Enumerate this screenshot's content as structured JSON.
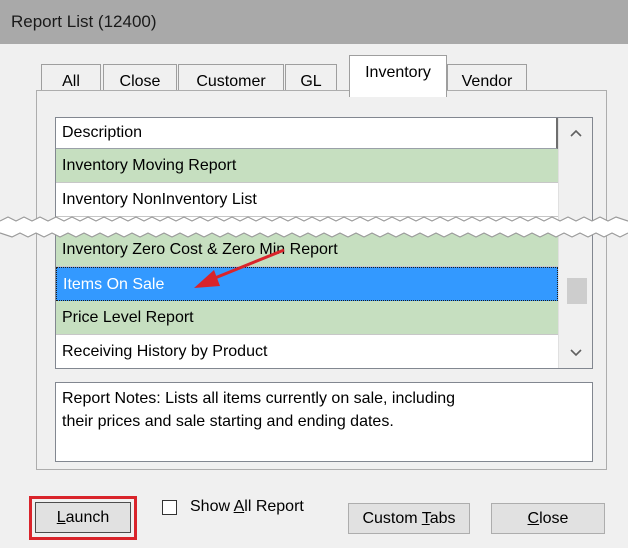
{
  "window": {
    "title": "Report List (12400)"
  },
  "tabs": [
    {
      "label": "All",
      "active": false
    },
    {
      "label": "Close",
      "active": false
    },
    {
      "label": "Customer",
      "active": false
    },
    {
      "label": "GL",
      "active": false
    },
    {
      "label": "Inventory",
      "active": true
    },
    {
      "label": "Vendor",
      "active": false
    }
  ],
  "list": {
    "header": "Description",
    "rows": [
      {
        "label": "Inventory Moving Report",
        "color": "#c6dfc0"
      },
      {
        "label": "Inventory NonInventory List",
        "color": "#ffffff"
      },
      {
        "label": "Inventory Zero Cost & Zero Min Report",
        "color": "#c6dfc0"
      },
      {
        "label": "Items On Sale",
        "selected": true,
        "color": "#3399ff"
      },
      {
        "label": "Price Level Report",
        "color": "#c6dfc0"
      },
      {
        "label": "Receiving History by Product",
        "color": "#ffffff"
      }
    ],
    "scroll_up_icon": "chevron-up-icon",
    "scroll_down_icon": "chevron-down-icon"
  },
  "notes": {
    "line1": "Report Notes:  Lists all items currently on sale, including",
    "line2": "their prices and sale starting and ending dates."
  },
  "buttons": {
    "launch": {
      "prefix": "",
      "accel": "L",
      "rest": "aunch"
    },
    "show_all": {
      "prefix": "Show ",
      "accel": "A",
      "rest": "ll Report",
      "checked": false
    },
    "custom_tabs": {
      "prefix": "Custom ",
      "accel": "T",
      "rest": "abs"
    },
    "close": {
      "prefix": "",
      "accel": "C",
      "rest": "lose"
    }
  },
  "annotations": {
    "arrow_color": "#d9242b",
    "highlight_color": "#d9242b"
  }
}
